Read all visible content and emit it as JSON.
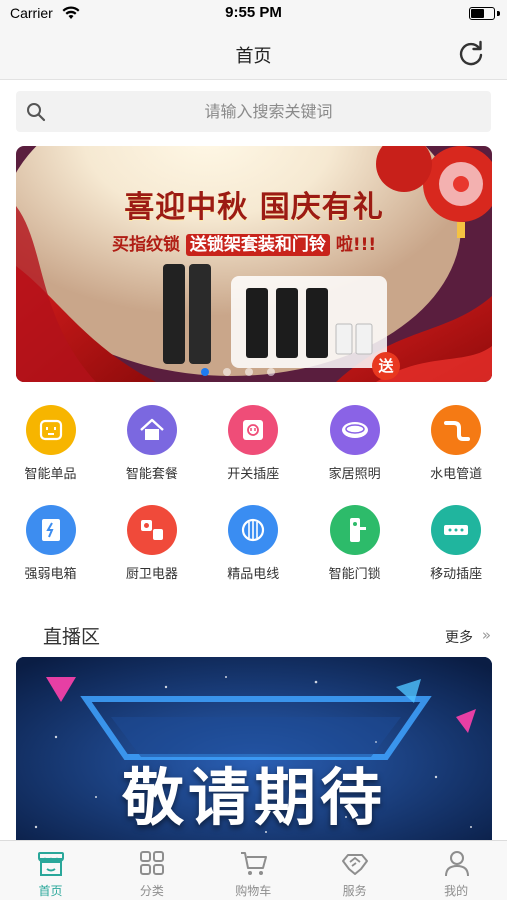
{
  "status_bar": {
    "carrier": "Carrier",
    "time": "9:55 PM",
    "battery_level": 0.65
  },
  "nav": {
    "title": "首页",
    "refresh_icon": "refresh-icon"
  },
  "search": {
    "placeholder": "请输入搜索关键词",
    "icon": "search-icon"
  },
  "banner": {
    "headline": "喜迎中秋 国庆有礼",
    "sub_before": "买指纹锁",
    "sub_highlight": "送锁架套装和门铃",
    "sub_after": "啦!!!",
    "gift_badge": "送",
    "slide_count": 4,
    "active_slide": 1
  },
  "categories": [
    {
      "label": "智能单品",
      "icon": "smart-socket-icon",
      "color": "#f7b500"
    },
    {
      "label": "智能套餐",
      "icon": "house-icon",
      "color": "#7b68e0"
    },
    {
      "label": "开关插座",
      "icon": "wall-outlet-icon",
      "color": "#ef4d78"
    },
    {
      "label": "家居照明",
      "icon": "ceiling-lamp-icon",
      "color": "#8a63e6"
    },
    {
      "label": "水电管道",
      "icon": "pipe-icon",
      "color": "#f57a14"
    },
    {
      "label": "强弱电箱",
      "icon": "electric-box-icon",
      "color": "#3d8df0"
    },
    {
      "label": "厨卫电器",
      "icon": "kitchen-appliance-icon",
      "color": "#f04a3a"
    },
    {
      "label": "精品电线",
      "icon": "cable-reel-icon",
      "color": "#3a8df2"
    },
    {
      "label": "智能门锁",
      "icon": "door-lock-icon",
      "color": "#2dbb6a"
    },
    {
      "label": "移动插座",
      "icon": "power-strip-icon",
      "color": "#20b59e"
    }
  ],
  "live": {
    "title": "直播区",
    "more": "更多",
    "more_icon": "double-chevron-right-icon",
    "banner_text": "敬请期待"
  },
  "tabs": [
    {
      "label": "首页",
      "icon": "shop-icon",
      "active": true
    },
    {
      "label": "分类",
      "icon": "grid-icon",
      "active": false
    },
    {
      "label": "购物车",
      "icon": "cart-icon",
      "active": false
    },
    {
      "label": "服务",
      "icon": "handshake-icon",
      "active": false
    },
    {
      "label": "我的",
      "icon": "user-icon",
      "active": false
    }
  ],
  "colors": {
    "accent": "#2aa79a",
    "tab_inactive": "#8e8e8e",
    "banner_red": "#c8231b"
  }
}
